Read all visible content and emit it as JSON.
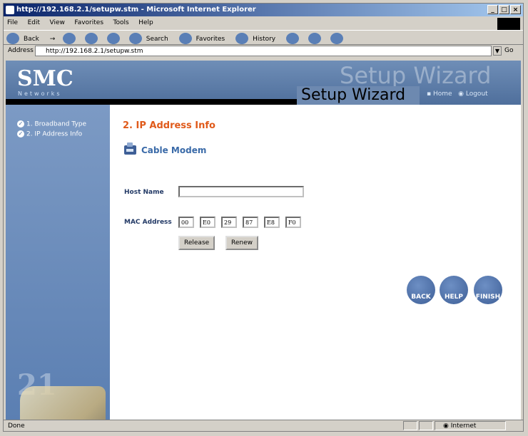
{
  "window": {
    "title": "http://192.168.2.1/setupw.stm - Microsoft Internet Explorer",
    "controls": [
      "_",
      "□",
      "×"
    ]
  },
  "menu": [
    "File",
    "Edit",
    "View",
    "Favorites",
    "Tools",
    "Help"
  ],
  "toolbar": {
    "back": "Back",
    "search": "Search",
    "favorites": "Favorites",
    "history": "History"
  },
  "address": {
    "label": "Address",
    "url": "http://192.168.2.1/setupw.stm",
    "go": "Go"
  },
  "banner": {
    "brand": "SMC",
    "tagline": "Networks",
    "bg_title": "Setup Wizard",
    "title": "Setup Wizard",
    "home": "Home",
    "logout": "Logout"
  },
  "sidebar": {
    "steps": [
      {
        "label": "1. Broadband Type"
      },
      {
        "label": "2. IP Address Info"
      }
    ]
  },
  "main": {
    "section_title": "2. IP Address Info",
    "connection_label": "Cable Modem",
    "host_label": "Host Name",
    "host_value": "",
    "mac_label": "MAC Address",
    "mac": [
      "00",
      "E0",
      "29",
      "87",
      "E8",
      "F0"
    ],
    "release": "Release",
    "renew": "Renew",
    "back": "BACK",
    "help": "HELP",
    "finish": "FINISH"
  },
  "status": {
    "text": "Done",
    "zone": "Internet"
  },
  "colors": {
    "accent": "#e05a1a",
    "sidebar": "#6d89b0",
    "link": "#3a6aa8"
  }
}
